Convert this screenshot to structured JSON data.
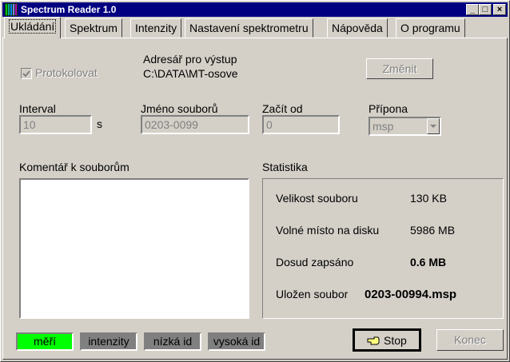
{
  "window": {
    "title": "Spectrum Reader 1.0",
    "controls": {
      "minimize": "_",
      "maximize": "□",
      "close": "×"
    }
  },
  "tabs": [
    {
      "label": "Ukládání",
      "active": true
    },
    {
      "label": "Spektrum"
    },
    {
      "label": "Intenzity"
    },
    {
      "label": "Nastavení spektrometru"
    },
    {
      "label": "Nápověda"
    },
    {
      "label": "O programu"
    }
  ],
  "save": {
    "protocol_label": "Protokolovat",
    "protocol_checked": true,
    "output_dir_label": "Adresář pro výstup",
    "output_dir_value": "C:\\DATA\\MT-osove",
    "change_button": "Změnit",
    "interval_label": "Interval",
    "interval_value": "10",
    "interval_unit": "s",
    "filename_label": "Jméno souborů",
    "filename_value": "0203-0099",
    "start_label": "Začít od",
    "start_value": "0",
    "extension_label": "Přípona",
    "extension_value": "msp",
    "comment_label": "Komentář k souborům",
    "comment_value": ""
  },
  "stats": {
    "title": "Statistika",
    "file_size_label": "Velikost souboru",
    "file_size_value": "130 KB",
    "free_space_label": "Volné místo na disku",
    "free_space_value": "5986 MB",
    "written_label": "Dosud zapsáno",
    "written_value": "0.6 MB",
    "saved_label": "Uložen soubor",
    "saved_value": "0203-00994.msp"
  },
  "indicators": [
    {
      "label": "měří",
      "color": "#00ff00"
    },
    {
      "label": "intenzity",
      "color": "#808080"
    },
    {
      "label": "nízká id",
      "color": "#808080"
    },
    {
      "label": "vysoká id",
      "color": "#808080"
    }
  ],
  "buttons": {
    "stop": "Stop",
    "stop_icon": "pointing-hand-icon",
    "exit": "Konec"
  }
}
